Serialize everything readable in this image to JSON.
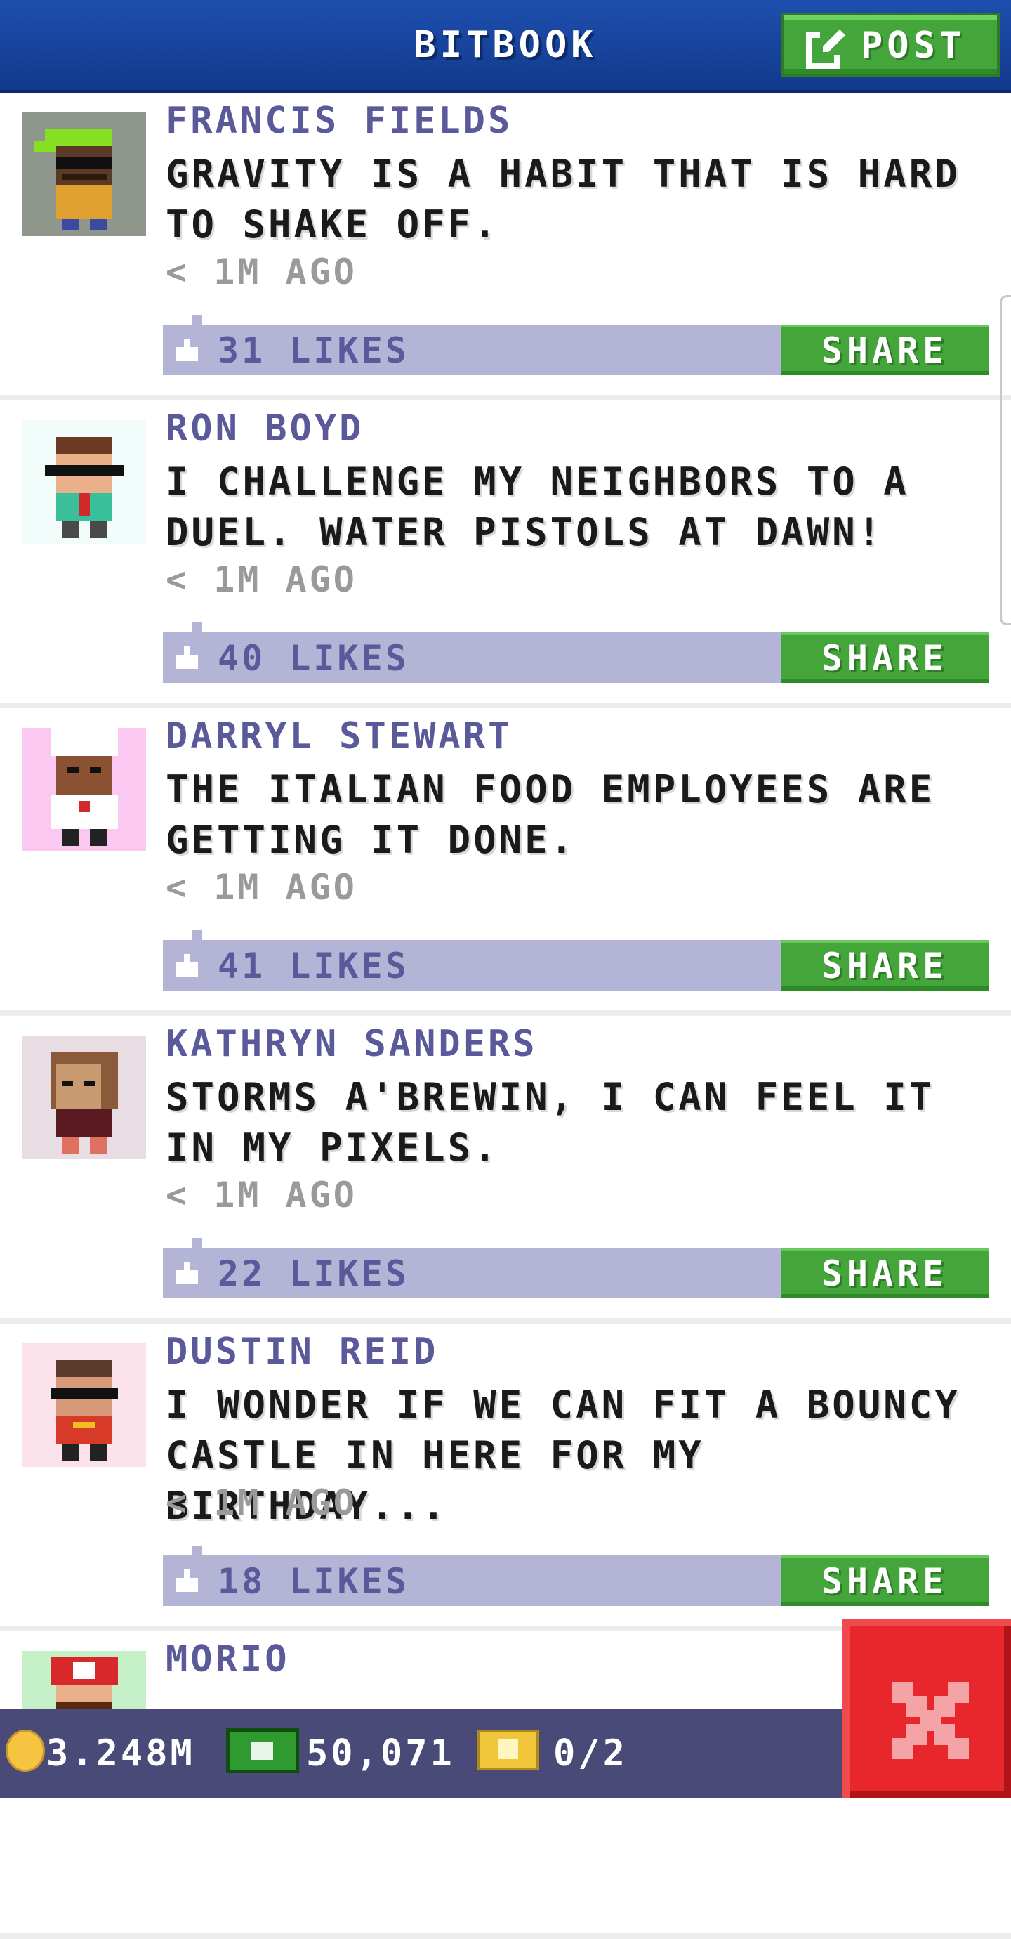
{
  "header": {
    "title": "BITBOOK",
    "post_label": "POST"
  },
  "posts": [
    {
      "author": "FRANCIS FIELDS",
      "message": "GRAVITY IS A HABIT THAT IS HARD TO SHAKE OFF.",
      "time": "< 1M AGO",
      "likes": "31 LIKES",
      "share": "SHARE"
    },
    {
      "author": "RON BOYD",
      "message": "I CHALLENGE MY NEIGHBORS TO A DUEL. WATER PISTOLS AT DAWN!",
      "time": "< 1M AGO",
      "likes": "40 LIKES",
      "share": "SHARE"
    },
    {
      "author": "DARRYL STEWART",
      "message": "THE ITALIAN FOOD EMPLOYEES ARE GETTING IT DONE.",
      "time": "< 1M AGO",
      "likes": "41 LIKES",
      "share": "SHARE"
    },
    {
      "author": "KATHRYN SANDERS",
      "message": "STORMS A'BREWIN, I CAN FEEL IT IN MY PIXELS.",
      "time": "< 1M AGO",
      "likes": "22 LIKES",
      "share": "SHARE"
    },
    {
      "author": "DUSTIN REID",
      "message": "I WONDER IF WE CAN FIT A BOUNCY CASTLE IN HERE FOR MY BIRTHDAY...",
      "time": "< 1M AGO",
      "likes": "18 LIKES",
      "share": "SHARE"
    },
    {
      "author": "MORIO",
      "message": "",
      "time": "",
      "likes": "",
      "share": ""
    }
  ],
  "footer": {
    "coins": "3.248M",
    "bux": "50,071",
    "tickets": "0/2"
  },
  "colors": {
    "header": "#1e4fae",
    "accent_green": "#44a63a",
    "like_bar": "#b4b4d6",
    "author_text": "#5a5a9a",
    "close_red": "#e8272c",
    "footer": "#4a4a78"
  },
  "icons": {
    "post": "edit-icon",
    "like": "thumbs-up-icon",
    "coin": "coin-icon",
    "bux": "bux-cash-icon",
    "ticket": "golden-ticket-icon",
    "close": "close-icon"
  }
}
